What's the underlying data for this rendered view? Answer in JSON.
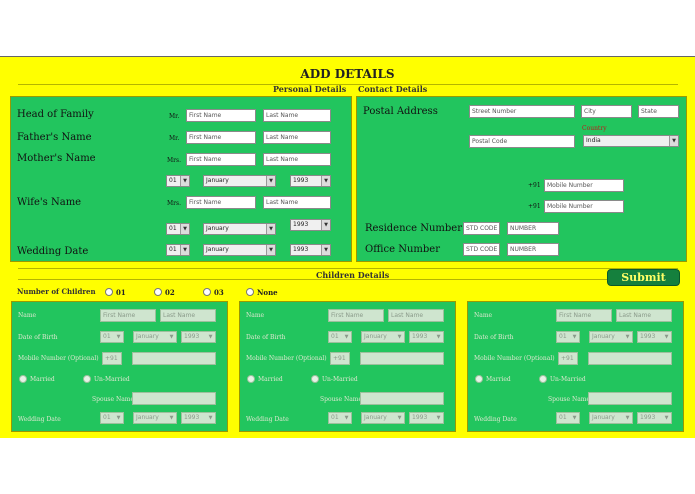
{
  "title": "ADD DETAILS",
  "sections": {
    "personal": "Personal Details",
    "contact": "Contact Details",
    "children": "Children Details"
  },
  "personal": {
    "head_label": "Head of Family",
    "father_label": "Father's Name",
    "mother_label": "Mother's Name",
    "wife_label": "Wife's Name",
    "wedding_label": "Wedding Date",
    "mr": "Mr.",
    "mrs": "Mrs.",
    "first_ph": "First Name",
    "last_ph": "Last Name",
    "day": "01",
    "month": "January",
    "year": "1993"
  },
  "contact": {
    "postal_label": "Postal Address",
    "street_ph": "Street Number",
    "city_ph": "City",
    "state_ph": "State",
    "postal_ph": "Postal Code",
    "country_label": "Country",
    "country_value": "India",
    "prefix": "+91",
    "mobile_ph": "Mobile Number",
    "residence_label": "Residence Number",
    "office_label": "Office Number",
    "std_ph": "STD CODE",
    "number_ph": "NUMBER"
  },
  "children": {
    "count_label": "Number of Children",
    "options": [
      "01",
      "02",
      "03",
      "None"
    ],
    "blocks": [
      {
        "name_label": "Name",
        "dob_label": "Date of Birth",
        "mobile_label": "Mobile Number (Optional)",
        "prefix": "+91",
        "opt1": "Married",
        "opt2": "Un-Married",
        "spouse_label": "Spouse Name",
        "wedding_label": "Wedding Date",
        "first_ph": "First Name",
        "last_ph": "Last Name",
        "day": "01",
        "month": "January",
        "year": "1993"
      },
      {
        "name_label": "Name",
        "dob_label": "Date of Birth",
        "mobile_label": "Mobile Number (Optional)",
        "prefix": "+91",
        "opt1": "Married",
        "opt2": "Un-Married",
        "spouse_label": "Spouse Name",
        "wedding_label": "Wedding Date",
        "first_ph": "First Name",
        "last_ph": "Last Name",
        "day": "01",
        "month": "January",
        "year": "1993"
      },
      {
        "name_label": "Name",
        "dob_label": "Date of Birth",
        "mobile_label": "Mobile Number (Optional)",
        "prefix": "+91",
        "opt1": "Married",
        "opt2": "Un-Married",
        "spouse_label": "Spouse Name",
        "wedding_label": "Wedding Date",
        "first_ph": "First Name",
        "last_ph": "Last Name",
        "day": "01",
        "month": "January",
        "year": "1993"
      }
    ]
  },
  "submit_label": "Submit",
  "colors": {
    "background": "#ffff00",
    "panel": "#22c55e",
    "submit": "#15803d",
    "submit_text": "#ffff66"
  }
}
